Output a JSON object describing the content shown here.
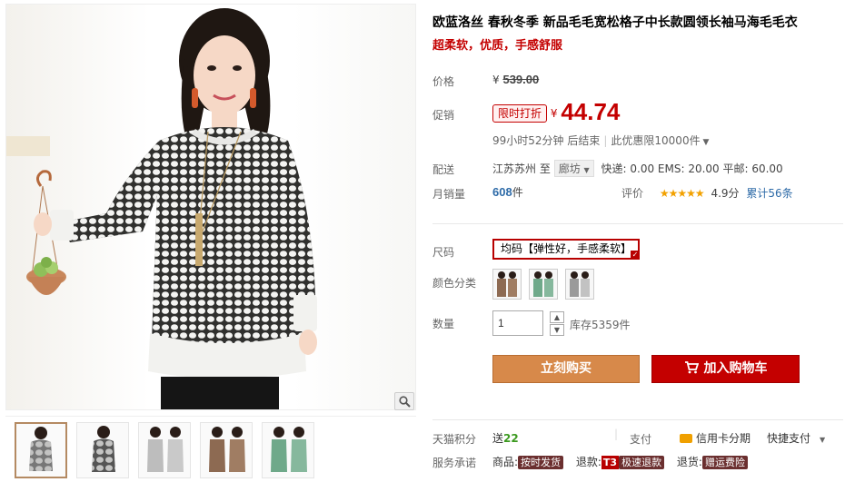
{
  "product": {
    "title": "欧蓝洛丝 春秋冬季 新品毛毛宽松格子中长款圆领长袖马海毛毛衣",
    "subtitle": "超柔软，优质，手感舒服"
  },
  "price": {
    "label": "价格",
    "currency": "¥",
    "original": "539.00"
  },
  "promo": {
    "label": "促销",
    "tag": "限时打折",
    "currency": "¥",
    "price": "44.74",
    "countdown": "99小时52分钟 后结束",
    "limit": "此优惠限10000件"
  },
  "shipping": {
    "label": "配送",
    "from": "江苏苏州",
    "to_word": "至",
    "destination": "廊坊",
    "rates": "快递: 0.00 EMS: 20.00 平邮: 60.00"
  },
  "sales": {
    "label": "月销量",
    "count": "608",
    "unit": "件",
    "rating_label": "评价",
    "stars": "★★★★★",
    "score": "4.9分",
    "reviews": "累计56条"
  },
  "size": {
    "label": "尺码",
    "option": "均码【弹性好，手感柔软】"
  },
  "color": {
    "label": "颜色分类",
    "swatches": [
      "brown",
      "green",
      "grey"
    ]
  },
  "quantity": {
    "label": "数量",
    "value": "1",
    "stock": "库存5359件"
  },
  "actions": {
    "buy_now": "立刻购买",
    "add_to_cart": "加入购物车"
  },
  "points": {
    "label": "天猫积分",
    "send": "送",
    "amount": "22",
    "payment_label": "支付",
    "credit": "信用卡分期",
    "fast_pay": "快捷支付"
  },
  "service": {
    "label": "服务承诺",
    "goods": "商品:",
    "goods_badge": "按时发货",
    "refund": "退款:",
    "refund_t3": "T3",
    "refund_badge": "极速退款",
    "return": "退货:",
    "return_badge": "赠运费险"
  },
  "colors": {
    "accent_red": "#c40000",
    "buy_orange": "#d7894a",
    "link_blue": "#2e6ba8"
  }
}
